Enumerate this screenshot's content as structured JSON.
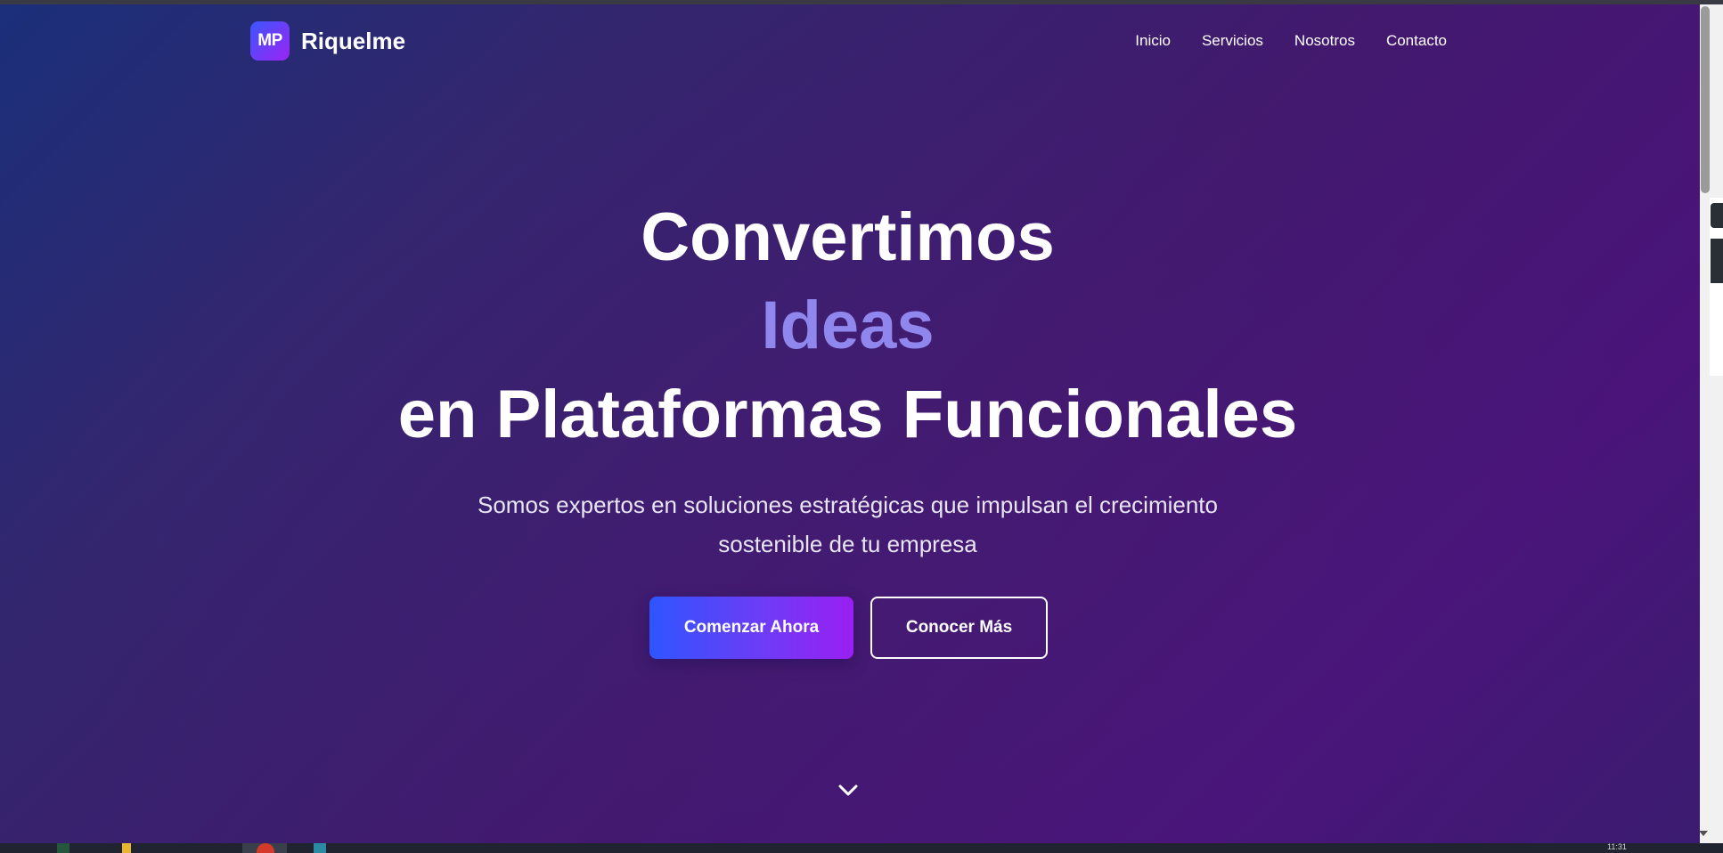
{
  "brand": {
    "logo_initials": "MP",
    "name": "Riquelme"
  },
  "nav": {
    "items": [
      {
        "label": "Inicio"
      },
      {
        "label": "Servicios"
      },
      {
        "label": "Nosotros"
      },
      {
        "label": "Contacto"
      }
    ]
  },
  "hero": {
    "line1": "Convertimos",
    "line2": "Ideas",
    "line3": "en Plataformas Funcionales",
    "subtitle_line1": "Somos expertos en soluciones estratégicas que impulsan el crecimiento",
    "subtitle_line2": "sostenible de tu empresa",
    "primary_cta": "Comenzar Ahora",
    "secondary_cta": "Conocer Más",
    "scroll_icon": "chevron-down-icon"
  },
  "colors": {
    "gradient_start": "#1b2f7a",
    "gradient_end": "#4a147a",
    "accent_text": "#8f86ee",
    "button_gradient_start": "#2f55ff",
    "button_gradient_end": "#9a1ff3"
  },
  "taskbar": {
    "clock": "11:31"
  }
}
